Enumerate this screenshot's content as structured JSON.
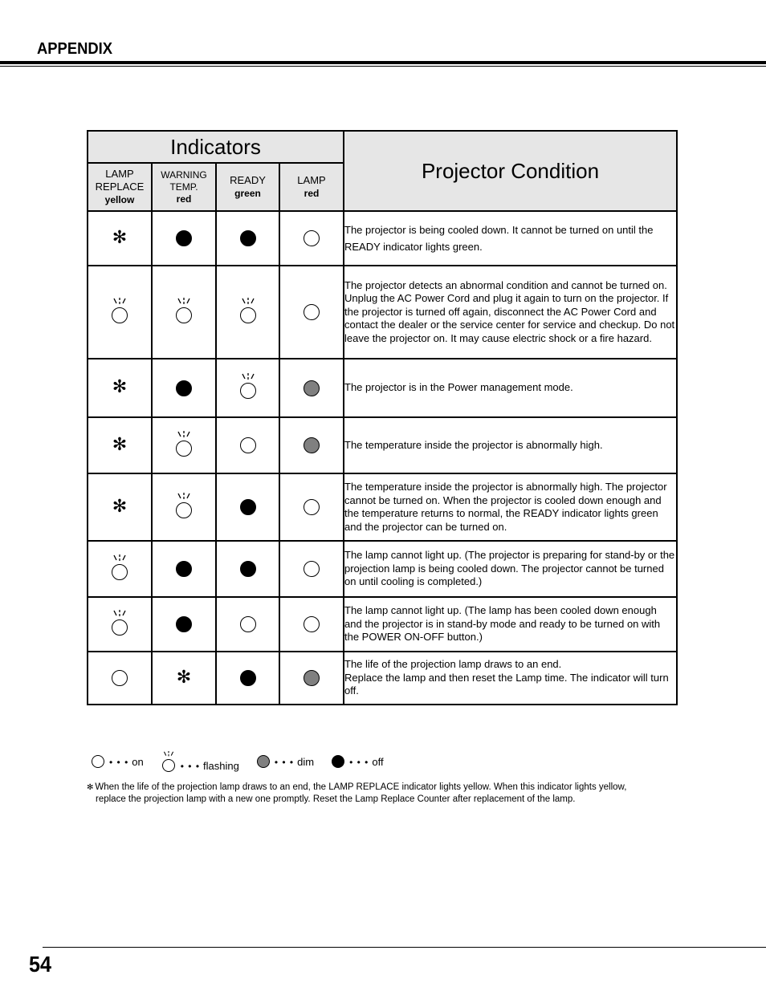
{
  "section_title": "APPENDIX",
  "page_number": "54",
  "table": {
    "indicators_title": "Indicators",
    "condition_title": "Projector Condition",
    "columns": [
      {
        "name": "LAMP REPLACE",
        "line1": "LAMP",
        "line2": "REPLACE",
        "color": "yellow"
      },
      {
        "name": "WARNING TEMP.",
        "line1": "WARNING",
        "line2": "TEMP.",
        "color": "red"
      },
      {
        "name": "READY",
        "line1": "READY",
        "line2": "",
        "color": "green"
      },
      {
        "name": "LAMP",
        "line1": "LAMP",
        "line2": "",
        "color": "red"
      }
    ],
    "rows": [
      {
        "states": [
          "asterisk",
          "off",
          "off",
          "on"
        ],
        "condition": "The projector is being cooled down. It cannot be turned on until the READY indicator lights green."
      },
      {
        "states": [
          "flashing",
          "flashing",
          "flashing",
          "on"
        ],
        "condition": "The projector detects an abnormal condition and cannot be turned on.  Unplug the AC Power Cord and plug it again to turn on the projector.  If the projector is turned off again, disconnect the AC Power Cord and contact the dealer or the service center for service and checkup.  Do not leave the projector on.  It may cause electric shock or a fire hazard."
      },
      {
        "states": [
          "asterisk",
          "off",
          "flashing",
          "dim"
        ],
        "condition": "The projector is in the Power management mode."
      },
      {
        "states": [
          "asterisk",
          "flashing",
          "on",
          "dim"
        ],
        "condition": "The temperature inside the projector is abnormally high."
      },
      {
        "states": [
          "asterisk",
          "flashing",
          "off",
          "on"
        ],
        "condition": "The temperature inside the projector is abnormally high. The projector cannot be turned on. When the projector is cooled down enough and the temperature returns to normal, the READY indicator lights green and the projector can be turned on."
      },
      {
        "states": [
          "flashing",
          "off",
          "off",
          "on"
        ],
        "condition": "The lamp cannot light up. (The projector is preparing for stand-by or the projection lamp is being cooled down. The projector cannot be turned on until cooling is completed.)"
      },
      {
        "states": [
          "flashing",
          "off",
          "on",
          "on"
        ],
        "condition": "The lamp cannot light up. (The lamp has been cooled down enough and the projector is in stand-by mode and ready to be turned on with the POWER ON-OFF button.)"
      },
      {
        "states": [
          "on",
          "asterisk",
          "off",
          "dim"
        ],
        "condition": "The life of the projection lamp draws to an end.\nReplace the lamp and then reset the Lamp time. The indicator will turn off."
      }
    ]
  },
  "legend": [
    {
      "state": "on",
      "dots": "• • •",
      "label": "on"
    },
    {
      "state": "flashing",
      "dots": "• • •",
      "label": "flashing"
    },
    {
      "state": "dim",
      "dots": "• • •",
      "label": "dim"
    },
    {
      "state": "off",
      "dots": "• • •",
      "label": "off"
    }
  ],
  "footnote": {
    "symbol": "✻",
    "line1": "When the life of the projection lamp draws to an end, the LAMP REPLACE indicator lights yellow.  When this indicator lights yellow,",
    "line2": "replace the projection lamp with a new one promptly.  Reset the Lamp Replace Counter after replacement of the lamp."
  },
  "colors": {
    "header_bg": "#e6e6e6",
    "dim": "#808080",
    "off": "#000000",
    "on": "#ffffff"
  }
}
